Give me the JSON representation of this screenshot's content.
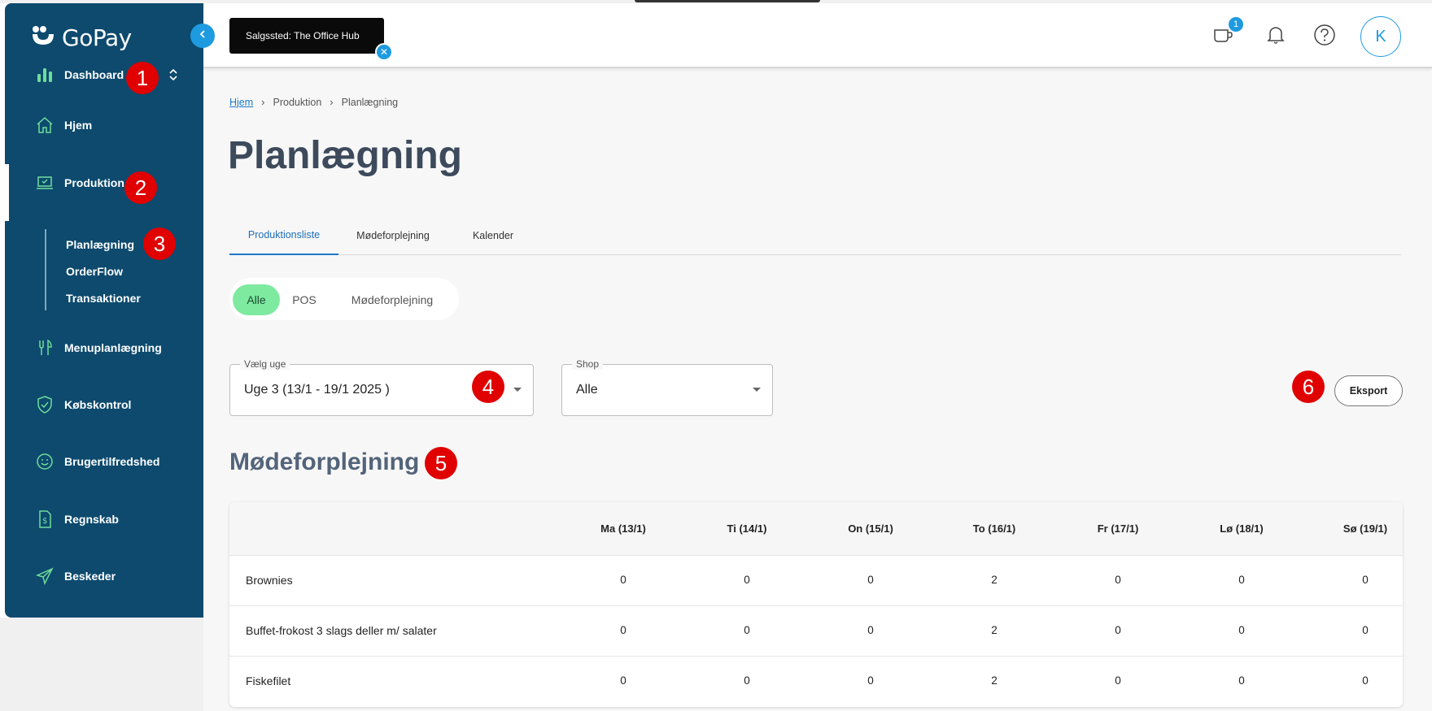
{
  "app": {
    "name": "GoPay"
  },
  "sidebar": {
    "items": [
      {
        "label": "Dashboard",
        "icon": "bar-chart-icon"
      },
      {
        "label": "Hjem",
        "icon": "home-icon"
      },
      {
        "label": "Produktion",
        "icon": "laptop-check-icon"
      },
      {
        "label": "Menuplanlægning",
        "icon": "fork-knife-icon"
      },
      {
        "label": "Købskontrol",
        "icon": "shield-check-icon"
      },
      {
        "label": "Brugertilfredshed",
        "icon": "smiley-icon"
      },
      {
        "label": "Regnskab",
        "icon": "receipt-icon"
      },
      {
        "label": "Beskeder",
        "icon": "paper-plane-icon"
      }
    ],
    "sub_items": [
      {
        "label": "Planlægning"
      },
      {
        "label": "OrderFlow"
      },
      {
        "label": "Transaktioner"
      }
    ]
  },
  "topbar": {
    "store_chip": "Salgssted: The Office Hub",
    "cup_badge": "1",
    "avatar_initial": "K"
  },
  "markers": [
    "1",
    "2",
    "3",
    "4",
    "5",
    "6"
  ],
  "breadcrumb": [
    "Hjem",
    "Produktion",
    "Planlægning"
  ],
  "page_title": "Planlægning",
  "tabs": [
    "Produktionsliste",
    "Mødeforplejning",
    "Kalender"
  ],
  "filters": [
    "Alle",
    "POS",
    "Mødeforplejning"
  ],
  "week_select": {
    "label": "Vælg uge",
    "value": "Uge 3 (13/1 - 19/1 2025 )"
  },
  "shop_select": {
    "label": "Shop",
    "value": "Alle"
  },
  "export_label": "Eksport",
  "section_title": "Mødeforplejning",
  "table": {
    "columns": [
      "Ma (13/1)",
      "Ti (14/1)",
      "On (15/1)",
      "To (16/1)",
      "Fr (17/1)",
      "Lø (18/1)",
      "Sø (19/1)"
    ],
    "rows": [
      {
        "name": "Brownies",
        "values": [
          "0",
          "0",
          "0",
          "2",
          "0",
          "0",
          "0"
        ]
      },
      {
        "name": "Buffet-frokost 3 slags deller m/ salater",
        "values": [
          "0",
          "0",
          "0",
          "2",
          "0",
          "0",
          "0"
        ]
      },
      {
        "name": "Fiskefilet",
        "values": [
          "0",
          "0",
          "0",
          "2",
          "0",
          "0",
          "0"
        ]
      }
    ]
  },
  "colors": {
    "sidebar": "#0d4a6e",
    "accent": "#1e9be0",
    "pill_active": "#7deaa0",
    "marker": "#e00000"
  }
}
